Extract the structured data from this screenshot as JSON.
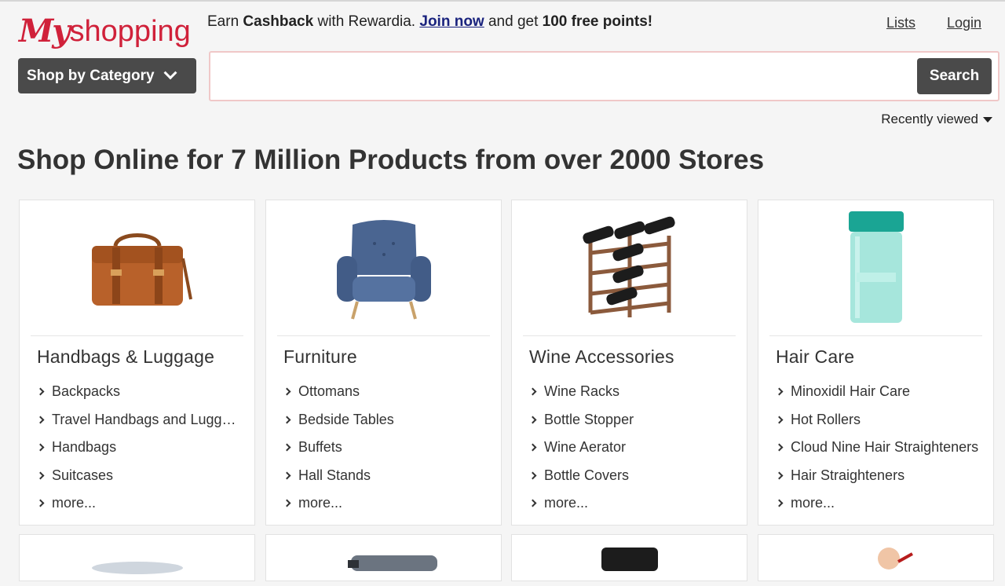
{
  "header": {
    "logo_my": "My",
    "logo_shopping": "shopping",
    "promo": {
      "earn": "Earn ",
      "cashback": "Cashback",
      "with": " with Rewardia. ",
      "join": "Join now",
      "and_get": " and get ",
      "points": "100 free points!"
    },
    "links": {
      "lists": "Lists",
      "login": "Login"
    },
    "category_button": "Shop by Category",
    "search": {
      "placeholder": "",
      "button": "Search"
    },
    "recently_viewed": "Recently viewed"
  },
  "headline": {
    "p1": "Shop Online",
    "p2": " for ",
    "p3": "7 Million Products",
    "p4": " from ",
    "p5": "over 2000 Stores"
  },
  "categories": [
    {
      "title": "Handbags & Luggage",
      "icon": "handbag-image",
      "items": [
        "Backpacks",
        "Travel Handbags and Luggage",
        "Handbags",
        "Suitcases",
        "more..."
      ]
    },
    {
      "title": "Furniture",
      "icon": "armchair-image",
      "items": [
        "Ottomans",
        "Bedside Tables",
        "Buffets",
        "Hall Stands",
        "more..."
      ]
    },
    {
      "title": "Wine Accessories",
      "icon": "wine-rack-image",
      "items": [
        "Wine Racks",
        "Bottle Stopper",
        "Wine Aerator",
        "Bottle Covers",
        "more..."
      ]
    },
    {
      "title": "Hair Care",
      "icon": "shampoo-bottle-image",
      "items": [
        "Minoxidil Hair Care",
        "Hot Rollers",
        "Cloud Nine Hair Straighteners",
        "Hair Straighteners",
        "more..."
      ]
    }
  ],
  "colors": {
    "brand": "#d0213a",
    "button": "#4a4a4a",
    "link": "#1a237e"
  }
}
